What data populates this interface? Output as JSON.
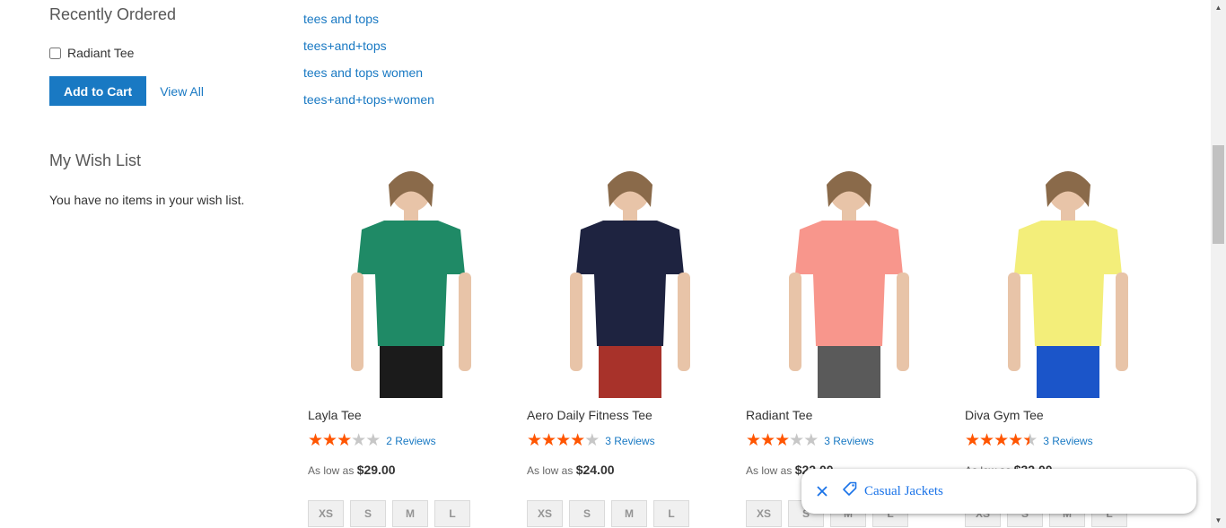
{
  "sidebar": {
    "recently_ordered": {
      "title": "Recently Ordered",
      "item_label": "Radiant Tee",
      "add_to_cart": "Add to Cart",
      "view_all": "View All"
    },
    "wishlist": {
      "title": "My Wish List",
      "empty_message": "You have no items in your wish list."
    }
  },
  "related_searches": [
    "tees and tops",
    "tees+and+tops",
    "tees and tops women",
    "tees+and+tops+women"
  ],
  "products": [
    {
      "name": "Layla Tee",
      "rating": 3,
      "reviews": "2 Reviews",
      "price_prefix": "As low as",
      "price": "$29.00",
      "sizes": [
        "XS",
        "S",
        "M",
        "L"
      ],
      "shirt_color": "#1f8a66",
      "bottom_color": "#1b1b1b"
    },
    {
      "name": "Aero Daily Fitness Tee",
      "rating": 4,
      "reviews": "3 Reviews",
      "price_prefix": "As low as",
      "price": "$24.00",
      "sizes": [
        "XS",
        "S",
        "M",
        "L"
      ],
      "shirt_color": "#1e2340",
      "bottom_color": "#a8322a"
    },
    {
      "name": "Radiant Tee",
      "rating": 3,
      "reviews": "3 Reviews",
      "price_prefix": "As low as",
      "price": "$22.00",
      "sizes": [
        "XS",
        "S",
        "M",
        "L"
      ],
      "shirt_color": "#f8968c",
      "bottom_color": "#5a5a5a"
    },
    {
      "name": "Diva Gym Tee",
      "rating": 4.5,
      "reviews": "3 Reviews",
      "price_prefix": "As low as",
      "price": "$32.00",
      "sizes": [
        "XS",
        "S",
        "M",
        "L"
      ],
      "shirt_color": "#f3ee7a",
      "bottom_color": "#1b55c9"
    }
  ],
  "toast": {
    "label": "Casual Jackets",
    "close_icon": "close-icon",
    "tag_icon": "tag-icon"
  },
  "colors": {
    "link": "#1979c3",
    "star_on": "#ff5501",
    "star_off": "#c7c7c7",
    "button": "#1979c3",
    "toast_text": "#1a73e8"
  }
}
